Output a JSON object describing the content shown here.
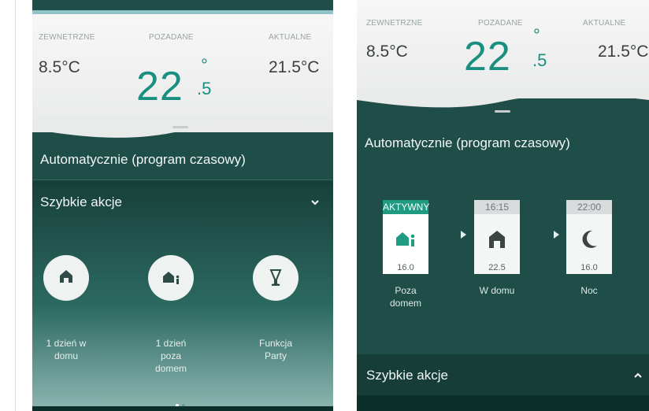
{
  "left_panel": {
    "labels": {
      "outdoor": "ZEWNETRZNE",
      "desired": "POZADANE",
      "current": "AKTUALNE"
    },
    "values": {
      "outdoor": "8.5°C",
      "desired_int": "22",
      "desired_dec": ".5",
      "degree": "°",
      "current": "21.5°C"
    },
    "mode": "Automatycznie (program czasowy)",
    "quick_actions": {
      "title": "Szybkie akcje",
      "items": [
        {
          "label_line1": "1 dzień w",
          "label_line2": "domu",
          "label_line3": ""
        },
        {
          "label_line1": "1 dzień",
          "label_line2": "poza",
          "label_line3": "domem"
        },
        {
          "label_line1": "Funkcja",
          "label_line2": "Party",
          "label_line3": ""
        }
      ]
    }
  },
  "right_panel": {
    "labels": {
      "outdoor": "ZEWNETRZNE",
      "desired": "POZADANE",
      "current": "AKTUALNE"
    },
    "values": {
      "outdoor": "8.5°C",
      "desired_int": "22",
      "desired_dec": ".5",
      "degree": "°",
      "current": "21.5°C"
    },
    "mode": "Automatycznie (program czasowy)",
    "schedule": [
      {
        "head": "AKTYWNY",
        "temp": "16.0",
        "name_line1": "Poza",
        "name_line2": "domem"
      },
      {
        "head": "16:15",
        "temp": "22.5",
        "name_line1": "W domu",
        "name_line2": ""
      },
      {
        "head": "22:00",
        "temp": "16.0",
        "name_line1": "Noc",
        "name_line2": ""
      }
    ],
    "quick_actions_title": "Szybkie akcje"
  },
  "colors": {
    "accent": "#1a8f7f",
    "active": "#1f9b82",
    "panel": "#1f4d47"
  }
}
